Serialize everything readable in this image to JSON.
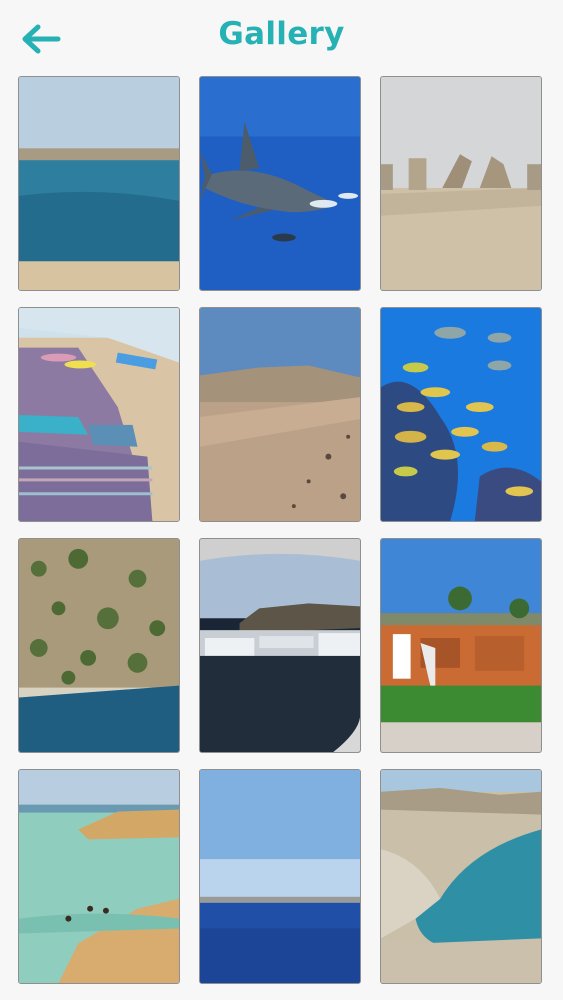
{
  "header": {
    "title": "Gallery",
    "back_icon": "arrow-left-icon"
  },
  "colors": {
    "accent": "#26b1b4",
    "background": "#f7f7f7",
    "tile_border": "#8f8f8f"
  },
  "gallery": {
    "photos": [
      {
        "subject": "lagoon-beach"
      },
      {
        "subject": "shark-underwater"
      },
      {
        "subject": "desert-gate"
      },
      {
        "subject": "beach-mats"
      },
      {
        "subject": "desert-road"
      },
      {
        "subject": "fish-school"
      },
      {
        "subject": "aerial-coast"
      },
      {
        "subject": "harbor-boats"
      },
      {
        "subject": "dive-shop"
      },
      {
        "subject": "shallow-reef-swimmers"
      },
      {
        "subject": "open-sea-horizon"
      },
      {
        "subject": "coastal-bay"
      }
    ]
  }
}
